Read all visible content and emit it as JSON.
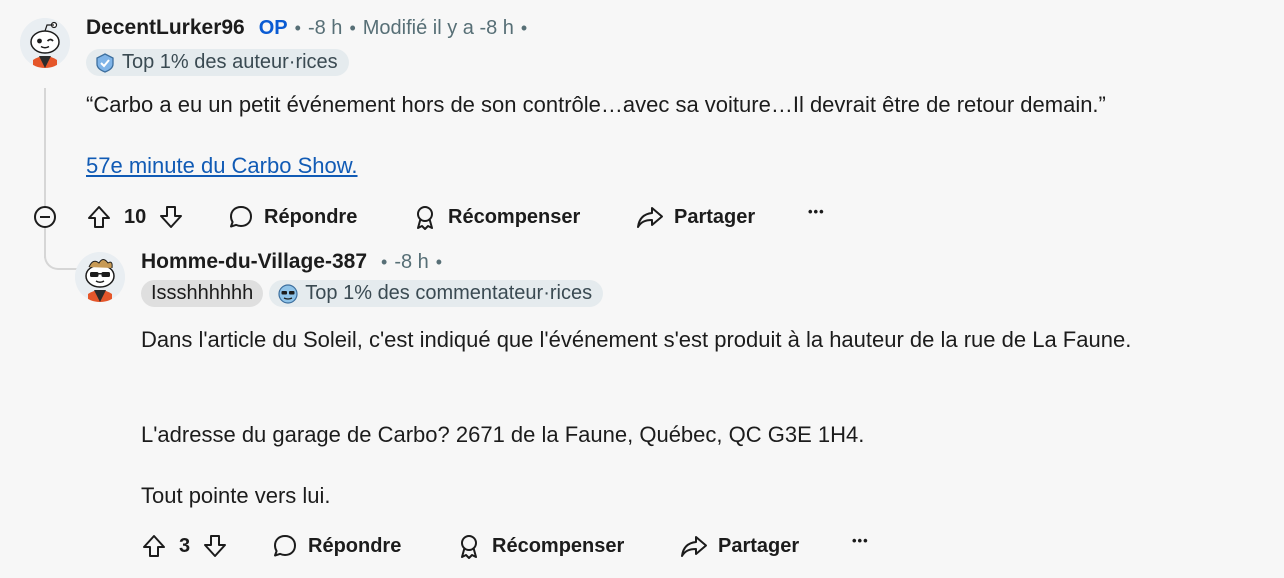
{
  "comment1": {
    "username": "DecentLurker96",
    "op_badge": "OP",
    "time": "-8 h",
    "edited": "Modifié il y a -8 h",
    "dot": "•",
    "achievement": "Top 1% des auteur·rices",
    "text": "“Carbo a eu un petit événement hors de son contrôle…avec sa voiture…Il devrait être de retour demain.”",
    "link": "57e minute du Carbo Show.",
    "votes": "10",
    "reply_label": "Répondre",
    "award_label": "Récompenser",
    "share_label": "Partager",
    "more_label": "•••"
  },
  "comment2": {
    "username": "Homme-du-Village-387",
    "time": "-8 h",
    "dot": "•",
    "flair": "Issshhhhhh",
    "achievement": "Top 1% des commentateur·rices",
    "paragraph1": "Dans l'article du Soleil, c'est indiqué que l'événement s'est produit à la hauteur de la rue de La Faune.",
    "paragraph2": "L'adresse du garage de Carbo? 2671 de la Faune, Québec, QC G3E 1H4.",
    "paragraph3": "Tout pointe vers lui.",
    "votes": "3",
    "reply_label": "Répondre",
    "award_label": "Récompenser",
    "share_label": "Partager",
    "more_label": "•••"
  },
  "colors": {
    "background": "#f7f7f7",
    "op_blue": "#0a5bd3",
    "link_blue": "#115bb5",
    "meta_gray": "#576f76",
    "pill_bg": "#e5ebee"
  },
  "icons": [
    "snoo-avatar-icon",
    "snoo-sunglasses-avatar-icon",
    "achievement-icon",
    "upvote-icon",
    "downvote-icon",
    "comment-icon",
    "award-icon",
    "share-icon",
    "collapse-icon"
  ]
}
